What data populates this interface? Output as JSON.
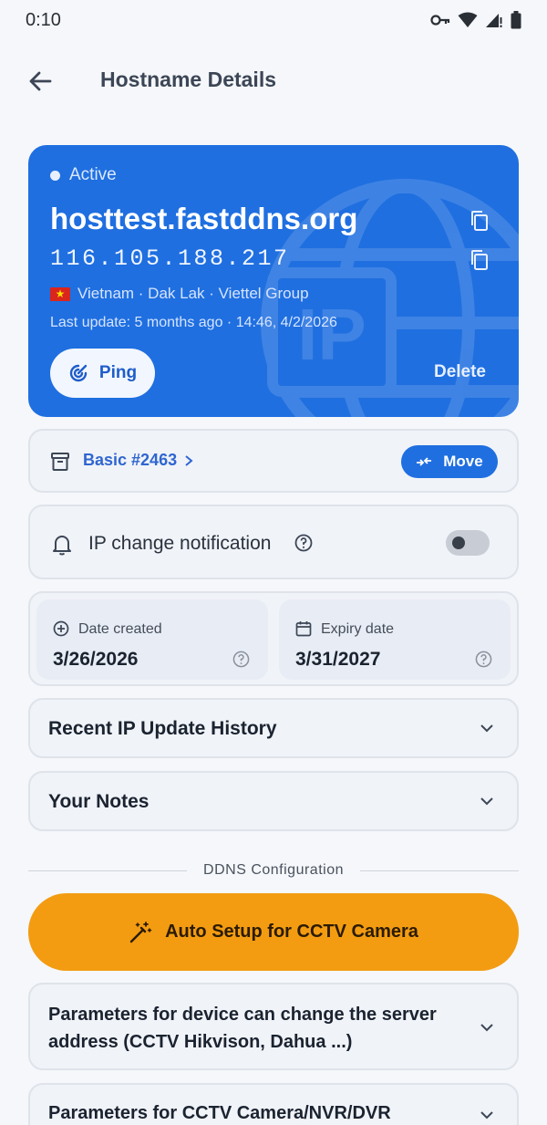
{
  "status_bar": {
    "time": "0:10"
  },
  "app_bar": {
    "title": "Hostname Details"
  },
  "hero": {
    "status": "Active",
    "hostname": "hosttest.fastddns.org",
    "ip": "116.105.188.217",
    "location": "Vietnam · Dak Lak · Viettel Group",
    "last_update": "Last update: 5 months ago · 14:46, 4/2/2026",
    "ping_label": "Ping",
    "delete_label": "Delete",
    "bg_text": "IP"
  },
  "plan": {
    "label": "Basic #2463",
    "move_label": "Move"
  },
  "notification": {
    "label": "IP change notification",
    "enabled": false
  },
  "dates": {
    "created_label": "Date created",
    "created_value": "3/26/2026",
    "expiry_label": "Expiry date",
    "expiry_value": "3/31/2027"
  },
  "sections": {
    "history": "Recent IP Update History",
    "notes": "Your Notes",
    "divider": "DDNS Configuration",
    "auto_setup": "Auto Setup for CCTV Camera",
    "params_1": "Parameters for device can change the server address (CCTV Hikvison, Dahua ...)",
    "params_2": "Parameters for CCTV Camera/NVR/DVR"
  },
  "colors": {
    "primary": "#1f6fe0",
    "accent": "#f39c12",
    "background": "#f5f7fa"
  }
}
